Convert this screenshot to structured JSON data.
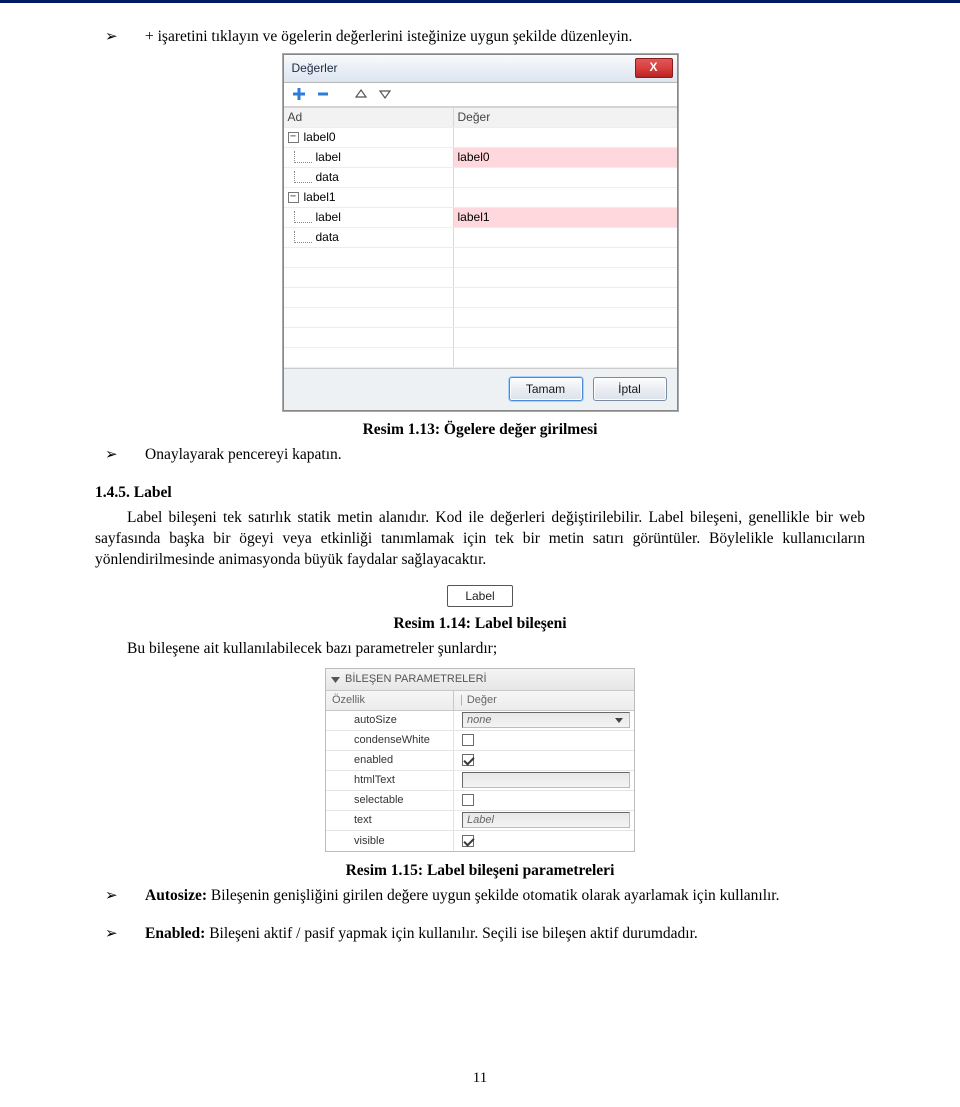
{
  "para1": "+ işaretini tıklayın ve ögelerin değerlerini isteğinize uygun şekilde düzenleyin.",
  "caption_dialog": "Resim 1.13: Ögelere değer girilmesi",
  "para2": "Onaylayarak pencereyi kapatın.",
  "section_heading": "1.4.5. Label",
  "para3": "Label bileşeni tek satırlık statik metin alanıdır. Kod ile değerleri değiştirilebilir. Label bileşeni, genellikle bir web sayfasında başka bir ögeyi veya etkinliği tanımlamak için tek bir metin satırı görüntüler. Böylelikle kullanıcıların yönlendirilmesinde animasyonda büyük faydalar sağlayacaktır.",
  "label_chip_text": "Label",
  "caption_labelchip": "Resim 1.14: Label bileşeni",
  "para4": "Bu bileşene ait kullanılabilecek bazı parametreler şunlardır;",
  "caption_params": "Resim 1.15: Label bileşeni parametreleri",
  "para5_label": "Autosize:",
  "para5_text": " Bileşenin genişliğini girilen değere uygun şekilde otomatik olarak ayarlamak için kullanılır.",
  "para6_label": "Enabled:",
  "para6_text": " Bileşeni aktif / pasif yapmak için kullanılır. Seçili ise bileşen aktif durumdadır.",
  "page_number": "11",
  "dialog": {
    "title": "Değerler",
    "close_glyph": "X",
    "col_name": "Ad",
    "col_value": "Değer",
    "rows": [
      {
        "level": 0,
        "expand": "−",
        "name": "label0",
        "value": ""
      },
      {
        "level": 1,
        "name": "label",
        "value": "label0",
        "pink": true
      },
      {
        "level": 1,
        "name": "data",
        "value": ""
      },
      {
        "level": 0,
        "expand": "−",
        "name": "label1",
        "value": ""
      },
      {
        "level": 1,
        "name": "label",
        "value": "label1",
        "pink": true
      },
      {
        "level": 1,
        "name": "data",
        "value": ""
      }
    ],
    "btn_ok": "Tamam",
    "btn_cancel": "İptal"
  },
  "params": {
    "panel_title": "BİLEŞEN PARAMETRELERİ",
    "col_prop": "Özellik",
    "col_value": "Değer",
    "rows": {
      "autoSize": {
        "label": "autoSize",
        "value": "none",
        "type": "dropdown"
      },
      "condenseWhite": {
        "label": "condenseWhite",
        "value": "",
        "type": "check",
        "checked": false
      },
      "enabled": {
        "label": "enabled",
        "value": "",
        "type": "check",
        "checked": true
      },
      "htmlText": {
        "label": "htmlText",
        "value": "",
        "type": "text"
      },
      "selectable": {
        "label": "selectable",
        "value": "",
        "type": "check",
        "checked": false
      },
      "text": {
        "label": "text",
        "value": "Label",
        "type": "text"
      },
      "visible": {
        "label": "visible",
        "value": "",
        "type": "check",
        "checked": true
      }
    }
  }
}
